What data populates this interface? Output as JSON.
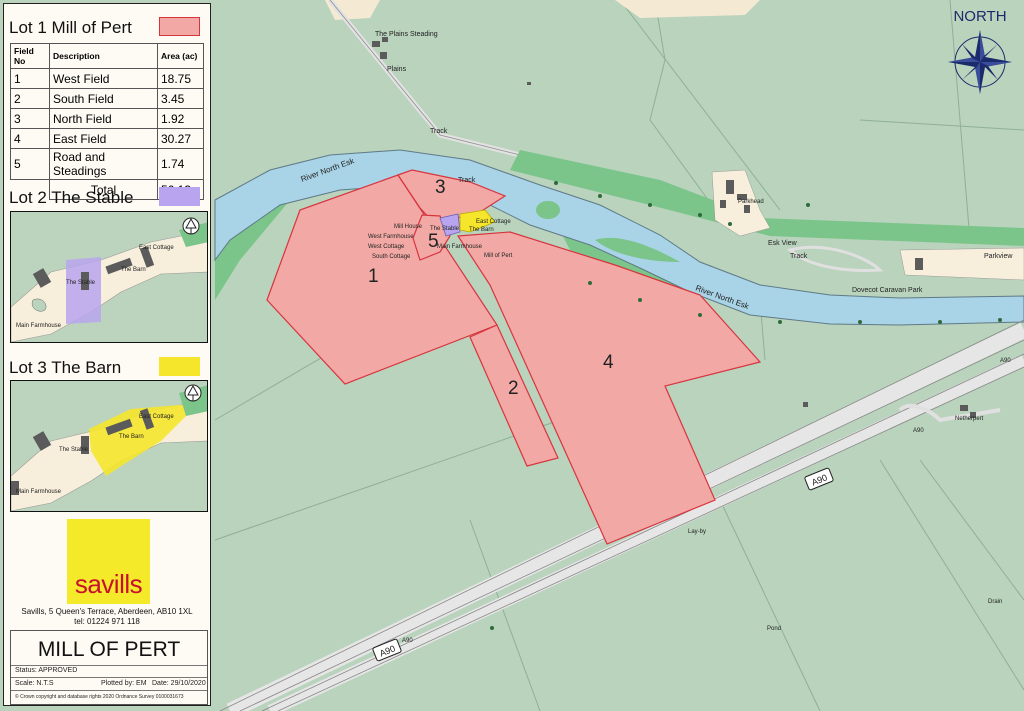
{
  "lot1": {
    "title": "Lot 1 Mill of Pert",
    "color": "#f2a9a5",
    "table": {
      "headers": [
        "Field No",
        "Description",
        "Area (ac)"
      ],
      "rows": [
        {
          "no": "1",
          "description": "West Field",
          "area": "18.75"
        },
        {
          "no": "2",
          "description": "South Field",
          "area": "3.45"
        },
        {
          "no": "3",
          "description": "North Field",
          "area": "1.92"
        },
        {
          "no": "4",
          "description": "East Field",
          "area": "30.27"
        },
        {
          "no": "5",
          "description": "Road and Steadings",
          "area": "1.74"
        }
      ],
      "total_label": "Total",
      "total_value": "56.13"
    }
  },
  "lot2": {
    "title": "Lot 2 The Stable",
    "color": "#b8a4ef",
    "inset_labels": {
      "east_cottage": "East Cottage",
      "stable": "The Stable",
      "barn": "The Barn",
      "main_farmhouse": "Main Farmhouse"
    }
  },
  "lot3": {
    "title": "Lot 3 The Barn",
    "color": "#f5e62c",
    "inset_labels": {
      "east_cottage": "East Cottage",
      "barn": "The Barn",
      "stable": "The Stable",
      "main_farmhouse": "Main Farmhouse"
    }
  },
  "agent": {
    "logo_text": "savills",
    "address": "Savills, 5 Queen's Terrace, Aberdeen, AB10 1XL",
    "tel": "tel: 01224 971 118"
  },
  "title_block": {
    "title": "MILL OF PERT",
    "status": "Status:  APPROVED",
    "scale": "Scale: N.T.S",
    "plotted_by": "Plotted by: EM",
    "date": "Date: 29/10/2020",
    "copyright": "© Crown copyright and database rights 2020 Ordnance Survey 0100031673"
  },
  "north_arrow": {
    "label": "NORTH"
  },
  "map": {
    "colors": {
      "field": "#b9d3bd",
      "river": "#a9d3e6",
      "woodland": "#7bc48a",
      "road": "#e6e6e6",
      "plot": "#f2a9a5",
      "plot_edge": "#d8343e",
      "settlement": "#f7efdc",
      "building": "#5b5b5b"
    },
    "field_numbers": [
      "1",
      "2",
      "3",
      "4",
      "5"
    ],
    "labels": {
      "the_plains_steading": "The Plains Steading",
      "plains": "Plains",
      "track_top": "Track",
      "track_mid": "Track",
      "track_east": "Track",
      "river_west": "River North Esk",
      "river_east": "River North Esk",
      "parkhead": "Parkhead",
      "esk_view": "Esk View",
      "parkview": "Parkview",
      "dovecot": "Dovecot Caravan Park",
      "mill_house": "Mill House",
      "west_farmhouse": "West Farmhouse",
      "west_cottage": "West Cottage",
      "south_cottage": "South Cottage",
      "the_stable": "The Stable",
      "east_cottage": "East Cottage",
      "the_barn": "The Barn",
      "main_farmhouse": "Main Farmhouse",
      "mill_of_pert": "Mill of Pert",
      "netherpert": "Netherpert",
      "a90_small_1": "A90",
      "a90_small_2": "A90",
      "a90_small_3": "A90",
      "a90_shield_1": "A90",
      "a90_shield_2": "A90",
      "lay_by": "Lay-by",
      "drain": "Drain",
      "pond": "Pond"
    }
  }
}
